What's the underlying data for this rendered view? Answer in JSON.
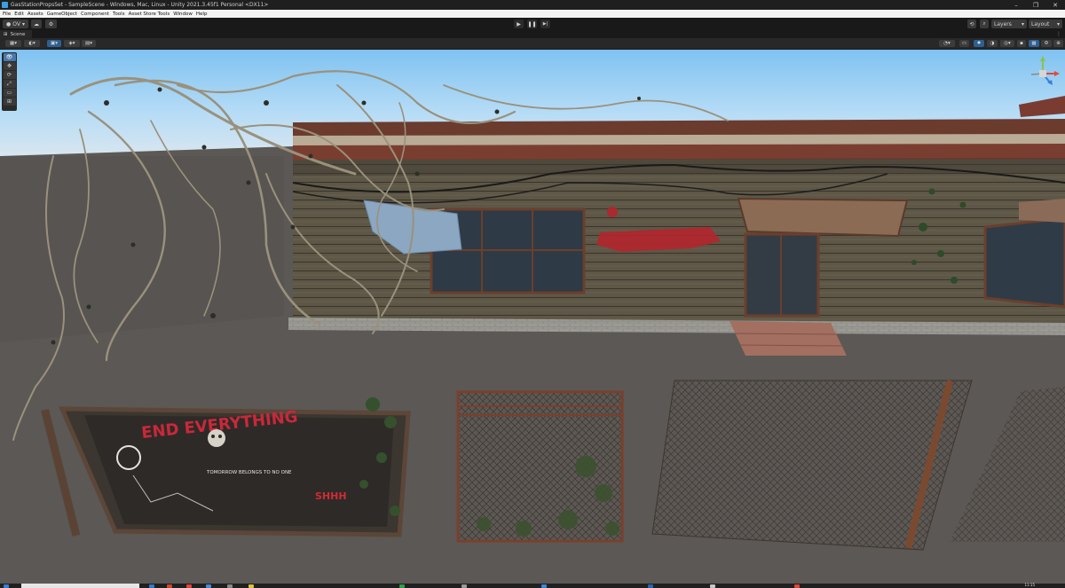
{
  "window": {
    "title": "GasStationPropsSet - SampleScene - Windows, Mac, Linux - Unity 2021.3.45f1 Personal <DX11>",
    "minimize_glyph": "–",
    "maximize_glyph": "❐",
    "close_glyph": "✕"
  },
  "menubar": {
    "items": [
      "File",
      "Edit",
      "Assets",
      "GameObject",
      "Component",
      "Tools",
      "Asset Store Tools",
      "Window",
      "Help"
    ]
  },
  "toolbar": {
    "account_label": "OV",
    "cloud_icon": "cloud-icon",
    "collab_icon": "services-icon",
    "play_glyph": "▶",
    "pause_glyph": "❚❚",
    "step_glyph": "▶|",
    "history_icon": "history-icon",
    "search_icon": "search-icon",
    "layers_label": "Layers",
    "layout_label": "Layout"
  },
  "scene_tab": {
    "label": "Scene"
  },
  "scene_toolbar": {
    "left_buttons": [
      "draw-mode",
      "render-paths",
      "2d-toggle",
      "lighting-toggle",
      "grid-snap"
    ],
    "right_buttons": [
      "gizmos",
      "audio",
      "effects",
      "lighting",
      "visibility",
      "camera",
      "scene-view-options",
      "gizmo-menu",
      "extra"
    ]
  },
  "tools": {
    "items": [
      "view-tool",
      "move-tool",
      "rotate-tool",
      "scale-tool",
      "rect-tool",
      "transform-tool"
    ]
  },
  "scene": {
    "graffiti_big": "END EVERYTHING",
    "graffiti_small": "TOMORROW BELONGS TO NO ONE",
    "graffiti_red": "SHHH"
  },
  "taskbar": {
    "time": "11:15"
  },
  "colors": {
    "editor_bg": "#1e1e1e",
    "toolbar_bg": "#191919",
    "accent": "#3c7fb1",
    "sky_top": "#7ec1f0",
    "ground": "#595653"
  }
}
